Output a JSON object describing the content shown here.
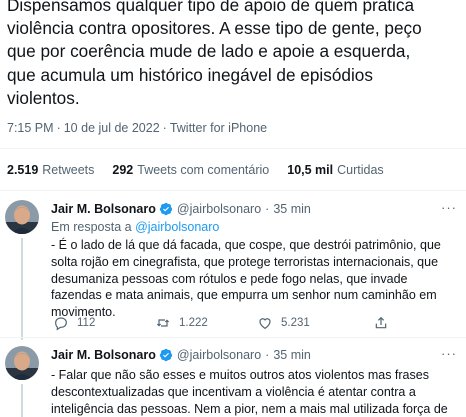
{
  "main_tweet": {
    "text": "Dispensamos qualquer tipo de apoio de quem pratica\nviolência contra opositores. A esse tipo de gente, peço\nque por coerência mude de lado e apoie a esquerda,\nque acumula um histórico inegável de episódios\nviolentos.",
    "time": "7:15 PM",
    "date": "10 de jul de 2022",
    "source": "Twitter for iPhone",
    "separator": "·"
  },
  "stats": {
    "retweets_count": "2.519",
    "retweets_label": "Retweets",
    "quotes_count": "292",
    "quotes_label": "Tweets com comentário",
    "likes_count": "10,5 mil",
    "likes_label": "Curtidas"
  },
  "replies": [
    {
      "name": "Jair M. Bolsonaro",
      "handle": "@jairbolsonaro",
      "separator": "·",
      "time": "35 min",
      "more": "···",
      "reply_prefix": "Em resposta a",
      "reply_handle": "@jairbolsonaro",
      "text": "- É o lado de lá que dá facada, que cospe, que destrói patrimônio, que solta rojão em cinegrafista, que protege terroristas internacionais, que desumaniza pessoas com rótulos e pede fogo nelas, que invade fazendas e mata animais, que empurra um senhor num caminhão em movimento.",
      "replies_count": "112",
      "retweets_count": "1.222",
      "likes_count": "5.231",
      "share_icon": "share-icon"
    },
    {
      "name": "Jair M. Bolsonaro",
      "handle": "@jairbolsonaro",
      "separator": "·",
      "time": "35 min",
      "more": "···",
      "text": "- Falar que não são esses e muitos outros atos violentos mas frases descontextualizadas que incentivam a violência é atentar contra a inteligência das pessoas. Nem a pior, nem a mais mal utilizada força de"
    }
  ],
  "colors": {
    "text": "#0f1419",
    "secondary": "#536471",
    "link": "#1d9bf0",
    "verified": "#1d9bf0",
    "divider": "#eff3f4"
  }
}
